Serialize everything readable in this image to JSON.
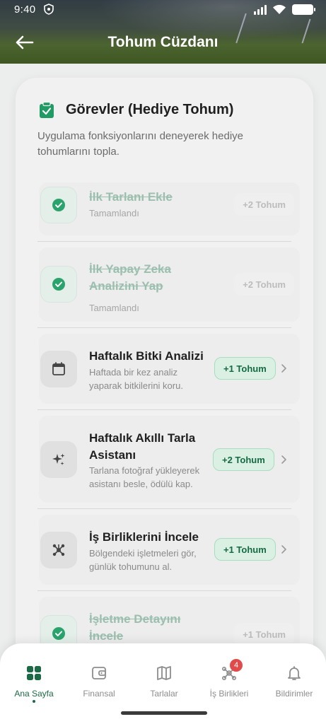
{
  "status": {
    "time": "9:40"
  },
  "header": {
    "title": "Tohum Cüzdanı"
  },
  "card": {
    "title": "Görevler (Hediye Tohum)",
    "description": "Uygulama fonksiyonlarını deneyerek hediye tohumlarını topla."
  },
  "tasks": [
    {
      "title": "İlk Tarlanı Ekle",
      "desc": "Tamamlandı",
      "reward": "+2 Tohum",
      "state": "completed",
      "icon": "check-icon"
    },
    {
      "title": "İlk Yapay Zeka Analizini Yap",
      "desc": "Tamamlandı",
      "reward": "+2 Tohum",
      "state": "completed",
      "icon": "check-icon"
    },
    {
      "title": "Haftalık Bitki Analizi",
      "desc": "Haftada bir kez analiz yaparak bitkilerini koru.",
      "reward": "+1 Tohum",
      "state": "pending",
      "icon": "calendar-icon"
    },
    {
      "title": "Haftalık Akıllı Tarla Asistanı",
      "desc": "Tarlana fotoğraf yükleyerek asistanı besle, ödülü kap.",
      "reward": "+2 Tohum",
      "state": "pending",
      "icon": "sparkle-icon"
    },
    {
      "title": "İş Birliklerini İncele",
      "desc": "Bölgendeki işletmeleri gör, günlük tohumunu al.",
      "reward": "+1 Tohum",
      "state": "pending",
      "icon": "network-icon"
    },
    {
      "title": "İşletme Detayını İncele",
      "desc": "",
      "reward": "+1 Tohum",
      "state": "completed",
      "icon": "check-icon"
    }
  ],
  "nav": {
    "items": [
      {
        "label": "Ana Sayfa",
        "icon": "grid-icon",
        "active": true
      },
      {
        "label": "Finansal",
        "icon": "wallet-icon"
      },
      {
        "label": "Tarlalar",
        "icon": "map-icon"
      },
      {
        "label": "İş Birlikleri",
        "icon": "network-icon",
        "badge": "4"
      },
      {
        "label": "Bildirimler",
        "icon": "bell-icon"
      }
    ]
  },
  "colors": {
    "accent": "#1c6a45",
    "reward_bg": "#d9f0e3",
    "badge": "#e14a4a"
  }
}
